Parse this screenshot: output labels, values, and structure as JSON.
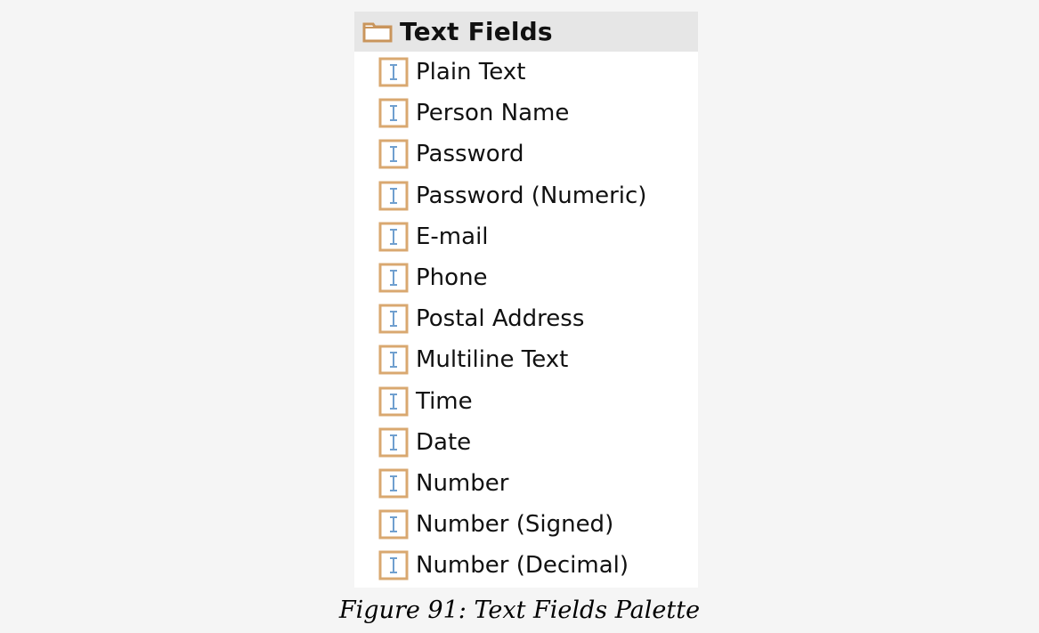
{
  "palette": {
    "header": {
      "label": "Text Fields",
      "icon": "folder-icon"
    },
    "items": [
      {
        "label": "Plain Text",
        "icon": "text-field-icon"
      },
      {
        "label": "Person Name",
        "icon": "text-field-icon"
      },
      {
        "label": "Password",
        "icon": "text-field-icon"
      },
      {
        "label": "Password (Numeric)",
        "icon": "text-field-icon"
      },
      {
        "label": "E-mail",
        "icon": "text-field-icon"
      },
      {
        "label": "Phone",
        "icon": "text-field-icon"
      },
      {
        "label": "Postal Address",
        "icon": "text-field-icon"
      },
      {
        "label": "Multiline Text",
        "icon": "text-field-icon"
      },
      {
        "label": "Time",
        "icon": "text-field-icon"
      },
      {
        "label": "Date",
        "icon": "text-field-icon"
      },
      {
        "label": "Number",
        "icon": "text-field-icon"
      },
      {
        "label": "Number (Signed)",
        "icon": "text-field-icon"
      },
      {
        "label": "Number (Decimal)",
        "icon": "text-field-icon"
      }
    ]
  },
  "caption": "Figure 91: Text Fields Palette",
  "colors": {
    "header_bg": "#e6e6e6",
    "folder_icon": "#c9955c",
    "field_icon_border": "#d9a870",
    "field_icon_cursor": "#6f9fcf"
  }
}
